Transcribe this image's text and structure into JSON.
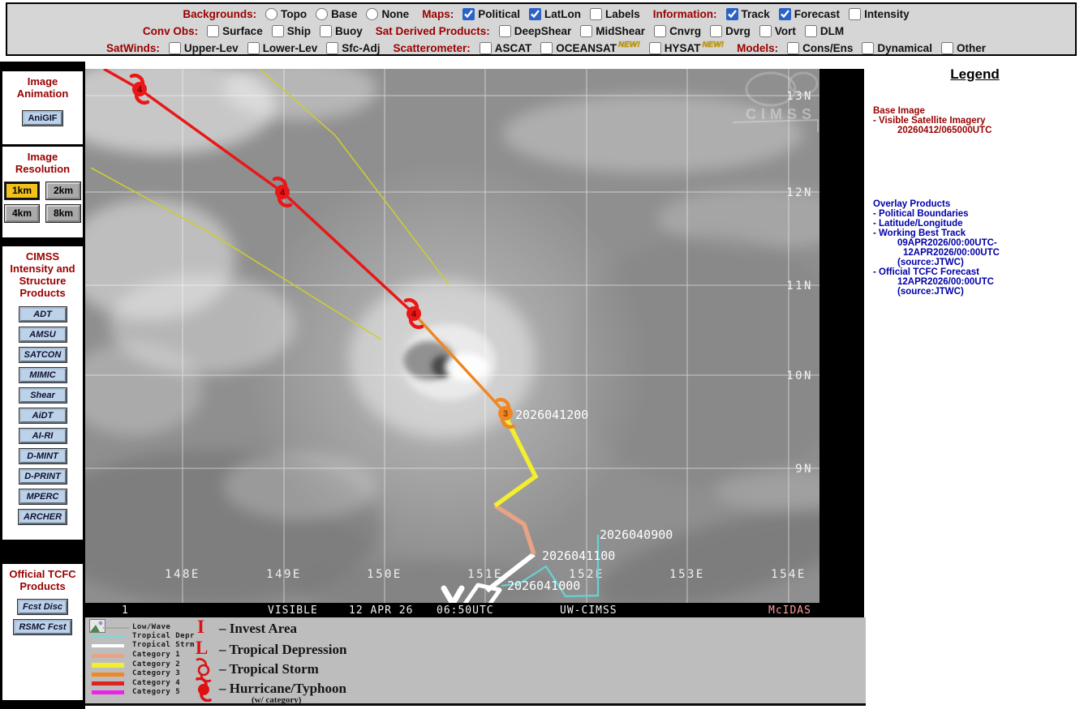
{
  "toolbar": {
    "backgrounds_label": "Backgrounds:",
    "backgrounds_options": [
      "Topo",
      "Base",
      "None"
    ],
    "maps_label": "Maps:",
    "maps_options": [
      "Political",
      "LatLon",
      "Labels"
    ],
    "information_label": "Information:",
    "information_options": [
      "Track",
      "Forecast",
      "Intensity"
    ],
    "convobs_label": "Conv Obs:",
    "convobs_options": [
      "Surface",
      "Ship",
      "Buoy"
    ],
    "satderived_label": "Sat Derived Products:",
    "satderived_options": [
      "DeepShear",
      "MidShear",
      "Cnvrg",
      "Dvrg",
      "Vort",
      "DLM"
    ],
    "satwinds_label": "SatWinds:",
    "satwinds_options": [
      "Upper-Lev",
      "Lower-Lev",
      "Sfc-Adj"
    ],
    "scatterometer_label": "Scatterometer:",
    "scatterometer_options": [
      "ASCAT",
      "OCEANSAT",
      "HYSAT"
    ],
    "new_badge": "NEW!",
    "models_label": "Models:",
    "models_options": [
      "Cons/Ens",
      "Dynamical",
      "Other"
    ]
  },
  "sidebar": {
    "animation_title_1": "Image",
    "animation_title_2": "Animation",
    "anigif_button": "AniGIF",
    "resolution_title_1": "Image",
    "resolution_title_2": "Resolution",
    "resolution_buttons": [
      "1km",
      "2km",
      "4km",
      "8km"
    ],
    "active_resolution": "1km",
    "cimss_title_1": "CIMSS",
    "cimss_title_2": "Intensity and",
    "cimss_title_3": "Structure",
    "cimss_title_4": "Products",
    "product_buttons": [
      "ADT",
      "AMSU",
      "SATCON",
      "MIMIC",
      "Shear",
      "AiDT",
      "AI-RI",
      "D-MINT",
      "D-PRINT",
      "MPERC",
      "ARCHER"
    ],
    "tcfc_title_1": "Official TCFC",
    "tcfc_title_2": "Products",
    "tcfc_buttons": [
      "Fcst Disc",
      "RSMC Fcst"
    ]
  },
  "map": {
    "lat_labels": [
      "13N",
      "12N",
      "11N",
      "10N",
      "9N"
    ],
    "lon_labels": [
      "148E",
      "149E",
      "150E",
      "151E",
      "152E",
      "153E",
      "154E"
    ],
    "track_labels": [
      "2026041200",
      "2026040900",
      "2026041100",
      "2026041000"
    ],
    "forecast_categories": [
      "4",
      "4",
      "4",
      "3"
    ],
    "watermark": "CIMSS",
    "bar": {
      "frame": "1",
      "product": "VISIBLE",
      "date": "12 APR 26",
      "time": "06:50UTC",
      "org": "UW-CIMSS",
      "system": "McIDAS"
    }
  },
  "overlay_legend": {
    "line_items": [
      {
        "label": "Low/Wave",
        "color": "#a8a8a8"
      },
      {
        "label": "Tropical Depr",
        "color": "#7fd8d8"
      },
      {
        "label": "Tropical Strm",
        "color": "#ffffff"
      },
      {
        "label": "Category 1",
        "color": "#e8a284"
      },
      {
        "label": "Category 2",
        "color": "#f2ee30"
      },
      {
        "label": "Category 3",
        "color": "#ef8722"
      },
      {
        "label": "Category 4",
        "color": "#dd2222"
      },
      {
        "label": "Category 5",
        "color": "#ee22ee"
      }
    ],
    "symbol_items": [
      {
        "symbol": "I",
        "label": "– Invest Area"
      },
      {
        "symbol": "L",
        "label": "– Tropical Depression"
      },
      {
        "symbol": "tropical-storm-icon",
        "label": "– Tropical Storm"
      },
      {
        "symbol": "hurricane-icon",
        "label": "– Hurricane/Typhoon"
      }
    ],
    "w_category_note": "(w/ category)"
  },
  "legend_panel": {
    "title": "Legend",
    "base_image_title": "Base Image",
    "base_image_lines": [
      "-  Visible Satellite Imagery",
      "20260412/065000UTC"
    ],
    "overlay_title": "Overlay Products",
    "overlay_lines": [
      "-  Political Boundaries",
      "-  Latitude/Longitude",
      "-  Working Best Track",
      "09APR2026/00:00UTC-",
      "12APR2026/00:00UTC",
      "(source:JTWC)",
      "-  Official TCFC Forecast",
      "12APR2026/00:00UTC",
      "(source:JTWC)"
    ]
  },
  "colors": {
    "checkbox_accent": "#2a62c8",
    "section_label_red": "#990000",
    "legend_blue": "#0000aa",
    "forecast_red": "#e81818",
    "forecast_orange": "#ef8722",
    "cone_yellow": "#cccc33",
    "active_resolution_yellow": "#f2c21c",
    "product_button_blue": "#bcd2e8"
  }
}
